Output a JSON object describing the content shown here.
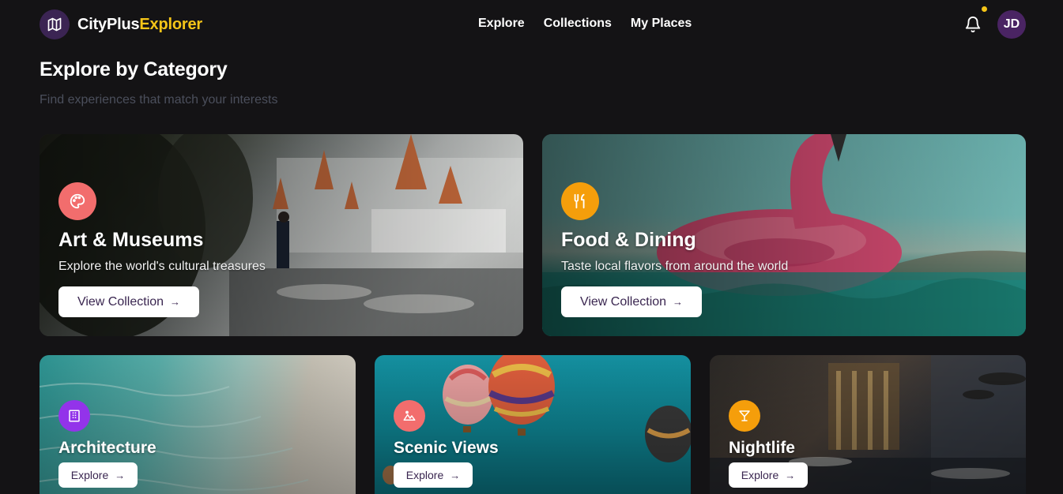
{
  "header": {
    "brand_part1": "CityPlus",
    "brand_part2": "Explorer",
    "brand_icon": "map-icon",
    "nav": [
      "Explore",
      "Collections",
      "My Places"
    ],
    "avatar_initials": "JD"
  },
  "section": {
    "title": "Explore by Category",
    "subtitle": "Find experiences that match your interests"
  },
  "featured": [
    {
      "title": "Art & Museums",
      "description": "Explore the world's cultural treasures",
      "button": "View Collection",
      "icon": "palette-icon",
      "icon_color": "#f26d6d"
    },
    {
      "title": "Food & Dining",
      "description": "Taste local flavors from around the world",
      "button": "View Collection",
      "icon": "utensils-icon",
      "icon_color": "#f59e0b"
    }
  ],
  "categories": [
    {
      "title": "Architecture",
      "button": "Explore",
      "icon": "building-icon",
      "icon_color": "#9333ea"
    },
    {
      "title": "Scenic Views",
      "button": "Explore",
      "icon": "mountain-icon",
      "icon_color": "#f26d6d"
    },
    {
      "title": "Nightlife",
      "button": "Explore",
      "icon": "cocktail-icon",
      "icon_color": "#f59e0b"
    }
  ],
  "colors": {
    "accent": "#f5c518",
    "brand_purple": "#3b2453",
    "background": "#141315"
  }
}
